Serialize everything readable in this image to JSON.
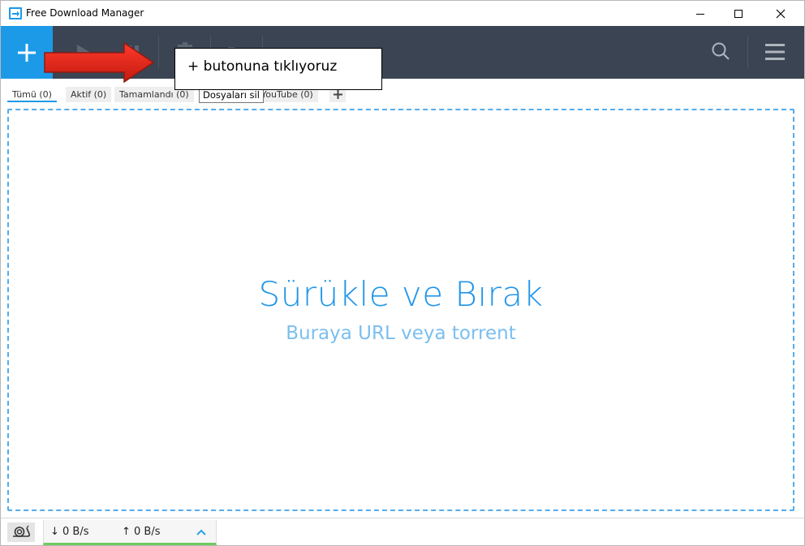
{
  "window": {
    "title": "Free Download Manager"
  },
  "tutorial": {
    "callout_text": "+ butonuna tıklıyoruz"
  },
  "tabs": [
    {
      "label": "Tümü (0)"
    },
    {
      "label": "Aktif (0)"
    },
    {
      "label": "Tamamlandı (0)"
    },
    {
      "label": "YouTube (0)"
    }
  ],
  "tooltip": {
    "text": "Dosyaları sil"
  },
  "dropzone": {
    "title": "Sürükle ve Bırak",
    "subtitle": "Buraya URL veya torrent"
  },
  "status": {
    "download_speed": "↓  0 B/s",
    "upload_speed": "↑ 0 B/s"
  },
  "icons": {
    "add": "plus-icon",
    "start": "play-icon",
    "pause": "pause-icon",
    "delete": "trash-icon",
    "move": "folder-icon",
    "search": "search-icon",
    "menu": "hamburger-menu-icon",
    "snail": "snail-icon",
    "expand": "chevron-up-icon"
  },
  "colors": {
    "accent": "#1c9ae8",
    "toolbar": "#3b4452",
    "arrow": "#e3261b",
    "speed_bar": "#6ccb5f"
  }
}
